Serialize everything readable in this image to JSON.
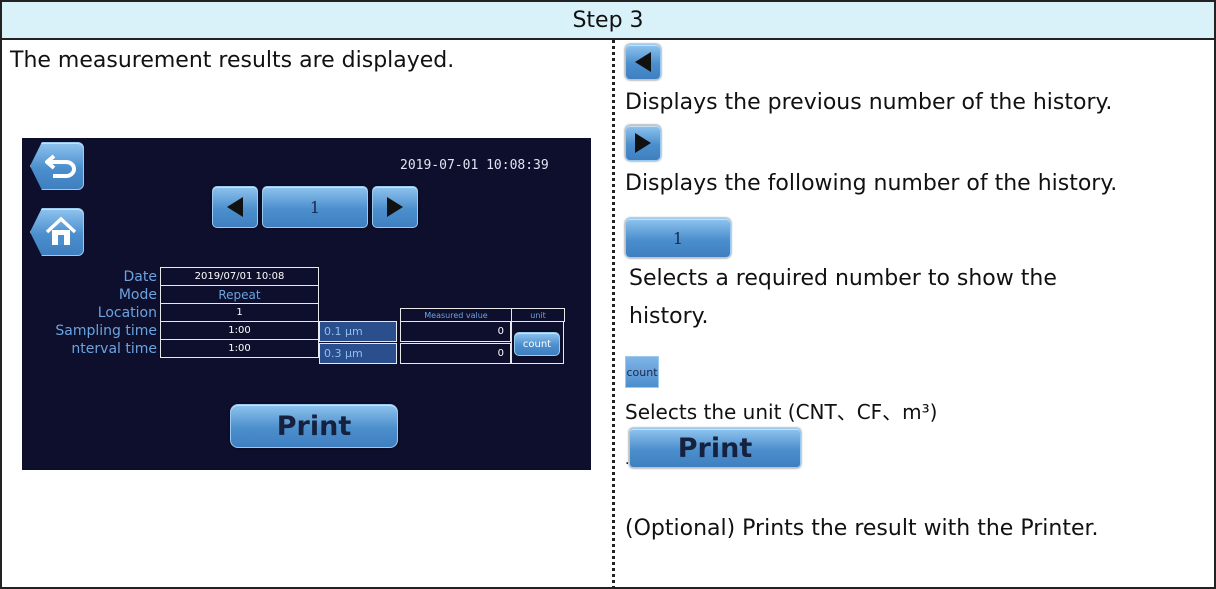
{
  "header": {
    "title": "Step 3"
  },
  "left": {
    "intro": "The measurement results are displayed.",
    "screen": {
      "datetime": "2019-07-01 10:08:39",
      "history_number": "1",
      "labels": [
        "Date",
        "Mode",
        "Location",
        "Sampling time",
        "nterval time"
      ],
      "values": [
        "2019/07/01 10:08",
        "Repeat",
        "1",
        "1:00",
        "1:00"
      ],
      "headers": {
        "measured_value": "Measured value",
        "unit": "unit"
      },
      "sizes": [
        "0.1 μm",
        "0.3 μm"
      ],
      "measured": [
        "0",
        "0"
      ],
      "unit_button": "count",
      "print_button": "Print"
    }
  },
  "right": {
    "prev_desc": "Displays the previous number of the history.",
    "next_desc": "Displays the following number of the history.",
    "number_label": "1",
    "number_desc_1": "Selects a required number to show the",
    "number_desc_2": "history.",
    "count_label": "count",
    "unit_desc": "Selects the unit (CNT、CF、m³)",
    "print_label": "Print",
    "dot": ".",
    "print_desc": "(Optional) Prints the result with the Printer."
  },
  "colors": {
    "header_bg": "#d9f1f8",
    "screen_bg": "#0d0f2c",
    "label_blue": "#6ba3e0",
    "button_blue": "#4c8fcd"
  },
  "icons": {
    "back": "back-arrow-icon",
    "home": "home-icon",
    "prev": "triangle-left-icon",
    "next": "triangle-right-icon"
  }
}
